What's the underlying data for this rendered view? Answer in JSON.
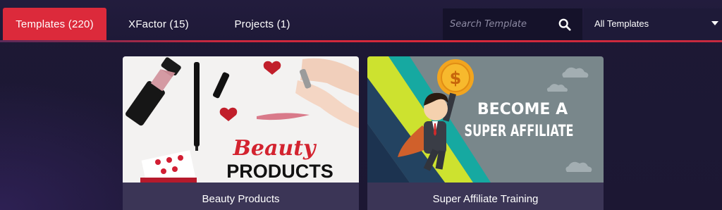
{
  "tabs": [
    {
      "label": "Templates (220)",
      "active": true
    },
    {
      "label": "XFactor (15)",
      "active": false
    },
    {
      "label": "Projects (1)",
      "active": false
    }
  ],
  "search": {
    "placeholder": "Search Template",
    "value": "",
    "icon": "search-icon"
  },
  "filter": {
    "selected": "All Templates",
    "icon": "chevron-down-icon"
  },
  "cards": [
    {
      "title": "Beauty Products",
      "thumb_text_1": "Beauty",
      "thumb_text_2": "PRODUCTS"
    },
    {
      "title": "Super Affiliate Training",
      "thumb_text_1": "BECOME A",
      "thumb_text_2": "SUPER AFFILIATE",
      "coin_symbol": "$"
    }
  ],
  "colors": {
    "accent": "#dc2a3b",
    "background": "#1c1733",
    "card_footer": "#3b3556"
  }
}
